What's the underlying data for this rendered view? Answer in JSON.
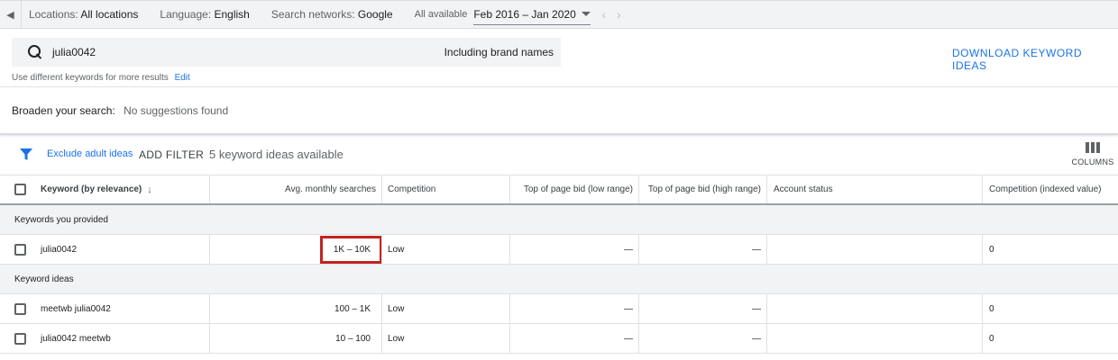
{
  "topbar": {
    "locations_label": "Locations:",
    "locations_value": "All locations",
    "language_label": "Language:",
    "language_value": "English",
    "networks_label": "Search networks:",
    "networks_value": "Google",
    "date_label": "All available",
    "date_value": "Feb 2016 – Jan 2020"
  },
  "search": {
    "query": "julia0042",
    "brand_toggle": "Including brand names",
    "download_label": "DOWNLOAD KEYWORD IDEAS",
    "hint": "Use different keywords for more results",
    "edit_label": "Edit"
  },
  "broaden": {
    "label": "Broaden your search:",
    "value": "No suggestions found"
  },
  "filter_bar": {
    "exclude_label": "Exclude adult ideas",
    "add_filter_label": "ADD FILTER",
    "count_label": "5 keyword ideas available",
    "columns_label": "COLUMNS"
  },
  "table": {
    "headers": {
      "keyword": "Keyword (by relevance)",
      "avg": "Avg. monthly searches",
      "competition": "Competition",
      "low_bid": "Top of page bid (low range)",
      "high_bid": "Top of page bid (high range)",
      "account": "Account status",
      "index": "Competition (indexed value)"
    },
    "group_provided": "Keywords you provided",
    "group_ideas": "Keyword ideas",
    "rows": [
      {
        "keyword": "julia0042",
        "avg": "1K – 10K",
        "competition": "Low",
        "low_bid": "—",
        "high_bid": "—",
        "account": "",
        "index": "0"
      },
      {
        "keyword": "meetwb julia0042",
        "avg": "100 – 1K",
        "competition": "Low",
        "low_bid": "—",
        "high_bid": "—",
        "account": "",
        "index": "0"
      },
      {
        "keyword": "julia0042 meetwb",
        "avg": "10 – 100",
        "competition": "Low",
        "low_bid": "—",
        "high_bid": "—",
        "account": "",
        "index": "0"
      }
    ]
  },
  "colors": {
    "accent": "#1a73e8",
    "highlight": "#c5221f"
  }
}
